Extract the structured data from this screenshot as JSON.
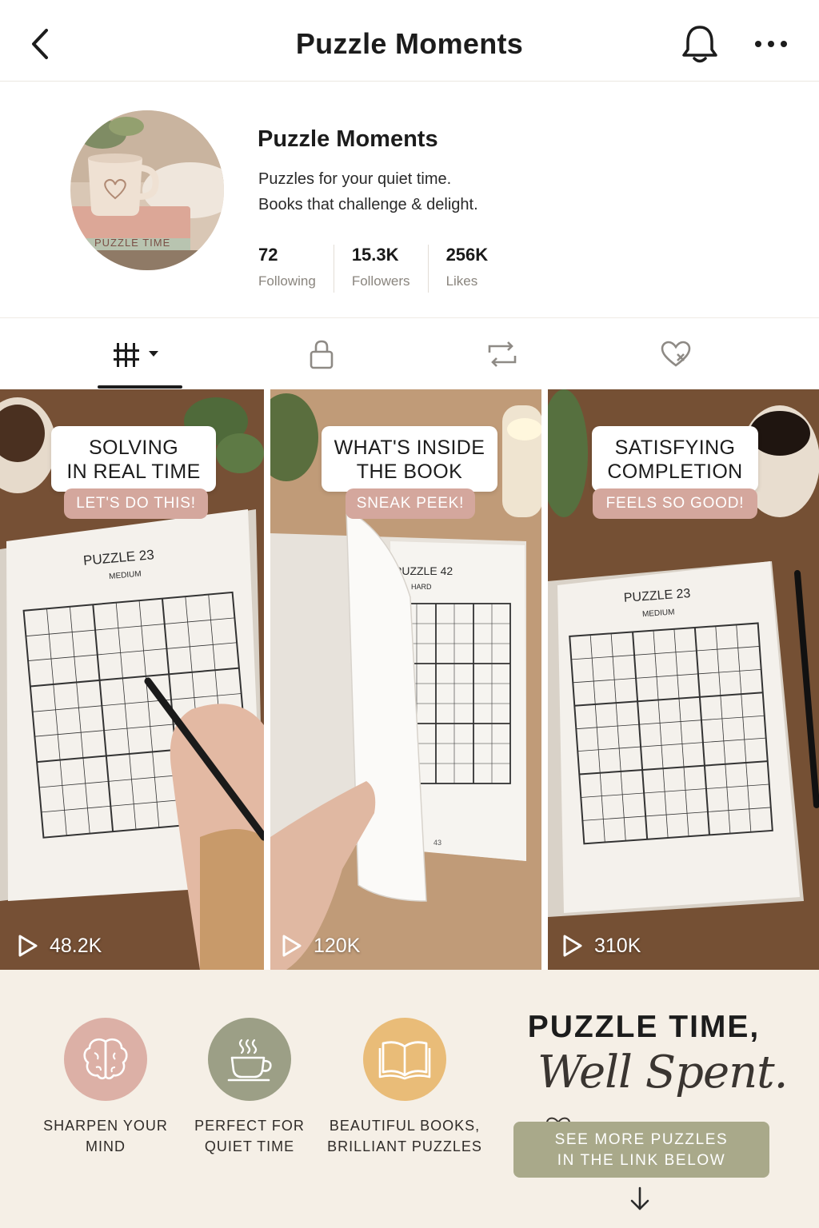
{
  "header": {
    "title": "Puzzle Moments"
  },
  "profile": {
    "name": "Puzzle Moments",
    "bio_line1": "Puzzles for your quiet time.",
    "bio_line2": "Books that challenge & delight.",
    "avatar_book_text": "PUZZLE TIME",
    "stats": [
      {
        "value": "72",
        "label": "Following"
      },
      {
        "value": "15.3K",
        "label": "Followers"
      },
      {
        "value": "256K",
        "label": "Likes"
      }
    ]
  },
  "tabs": [
    {
      "icon": "videos-grid-icon",
      "active": true
    },
    {
      "icon": "lock-icon",
      "active": false
    },
    {
      "icon": "repost-icon",
      "active": false
    },
    {
      "icon": "liked-heart-icon",
      "active": false
    }
  ],
  "videos": [
    {
      "caption_line1": "SOLVING",
      "caption_line2": "IN REAL TIME",
      "tag": "LET'S DO THIS!",
      "views": "48.2K",
      "puzzle_title": "PUZZLE 23",
      "puzzle_level": "MEDIUM"
    },
    {
      "caption_line1": "WHAT'S INSIDE",
      "caption_line2": "THE BOOK",
      "tag": "SNEAK PEEK!",
      "views": "120K",
      "puzzle_title": "PUZZLE 42",
      "puzzle_level": "HARD",
      "page_number": "43"
    },
    {
      "caption_line1": "SATISFYING",
      "caption_line2": "COMPLETION",
      "tag": "FEELS SO GOOD!",
      "views": "310K",
      "puzzle_title": "PUZZLE 23",
      "puzzle_level": "MEDIUM"
    }
  ],
  "features": [
    {
      "line1": "SHARPEN YOUR",
      "line2": "MIND",
      "icon": "brain-icon",
      "color": "#dcb0a6"
    },
    {
      "line1": "PERFECT FOR",
      "line2": "QUIET TIME",
      "icon": "tea-cup-icon",
      "color": "#9c9f86"
    },
    {
      "line1": "BEAUTIFUL BOOKS,",
      "line2": "BRILLIANT PUZZLES",
      "icon": "open-book-icon",
      "color": "#e9bc78"
    }
  ],
  "promo": {
    "headline": "PUZZLE TIME,",
    "script": "Well Spent.",
    "cta_line1": "SEE MORE PUZZLES",
    "cta_line2": "IN THE LINK BELOW"
  },
  "colors": {
    "accent_rose": "#d4a79d",
    "accent_sage": "#a9a98a",
    "banner_bg": "#f5efe6"
  }
}
